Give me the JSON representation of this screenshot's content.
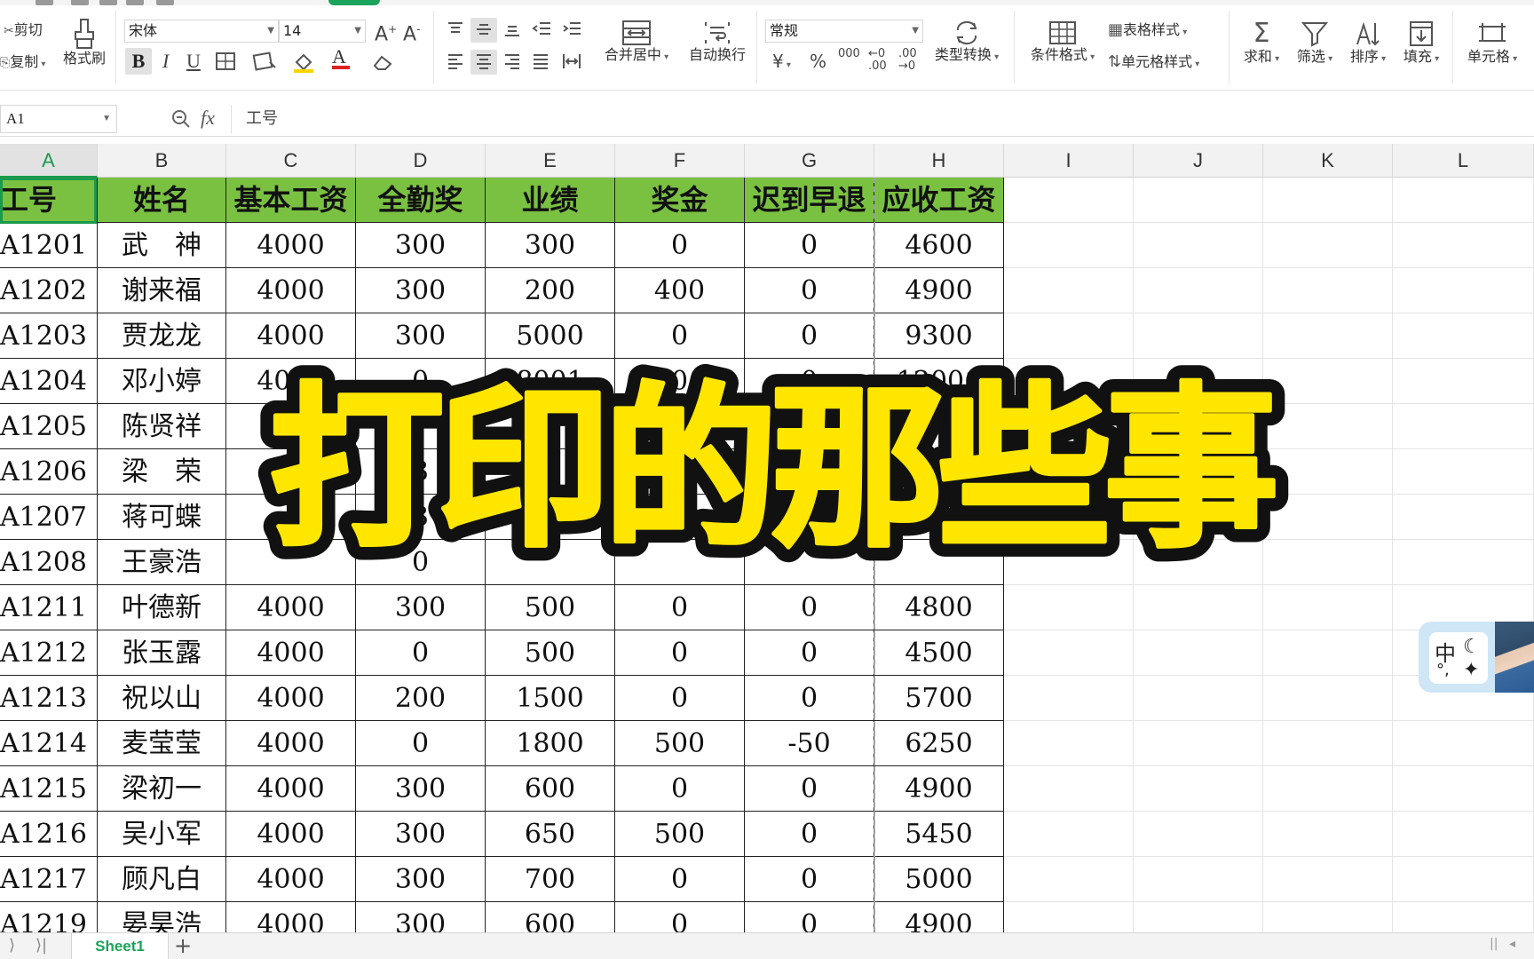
{
  "ribbon": {
    "clipboard": {
      "cut": "剪切",
      "copy": "复制",
      "format_painter": "格式刷"
    },
    "font": {
      "name": "宋体",
      "size": "14",
      "bold": "B",
      "italic": "I",
      "underline": "U",
      "color_letter": "A"
    },
    "alignment": {
      "merge_center": "合并居中",
      "wrap_text": "自动换行"
    },
    "number": {
      "format": "常规",
      "currency": "¥",
      "percent": "%",
      "thousands": "000",
      "type_convert": "类型转换"
    },
    "styles": {
      "conditional_format": "条件格式",
      "table_style": "表格样式",
      "cell_style": "单元格样式"
    },
    "editing": {
      "sum": "求和",
      "filter": "筛选",
      "sort": "排序",
      "fill": "填充",
      "cell": "单元格"
    },
    "accent_color": "#1aa35a"
  },
  "formula_bar": {
    "name_box": "A1",
    "fx": "fx",
    "content": "工号"
  },
  "columns": [
    "A",
    "B",
    "C",
    "D",
    "E",
    "F",
    "G",
    "H",
    "I",
    "J",
    "K",
    "L"
  ],
  "table": {
    "header": [
      "工号",
      "姓名",
      "基本工资",
      "全勤奖",
      "业绩",
      "奖金",
      "迟到早退",
      "应收工资"
    ],
    "header_color": "#7ac142",
    "rows": [
      [
        "A1201",
        "武　神",
        "4000",
        "300",
        "300",
        "0",
        "0",
        "4600"
      ],
      [
        "A1202",
        "谢来福",
        "4000",
        "300",
        "200",
        "400",
        "0",
        "4900"
      ],
      [
        "A1203",
        "贾龙龙",
        "4000",
        "300",
        "5000",
        "0",
        "0",
        "9300"
      ],
      [
        "A1204",
        "邓小婷",
        "4000",
        "0",
        "8001",
        "0",
        "0",
        "12001"
      ],
      [
        "A1205",
        "陈贤祥",
        "",
        "",
        "",
        "",
        "",
        ""
      ],
      [
        "A1206",
        "梁　荣",
        "",
        "3",
        "",
        "",
        "",
        ""
      ],
      [
        "A1207",
        "蒋可蝶",
        "",
        "3",
        "",
        "",
        "",
        ""
      ],
      [
        "A1208",
        "王豪浩",
        "",
        "0",
        "",
        "",
        "",
        ""
      ],
      [
        "A1211",
        "叶德新",
        "4000",
        "300",
        "500",
        "0",
        "0",
        "4800"
      ],
      [
        "A1212",
        "张玉露",
        "4000",
        "0",
        "500",
        "0",
        "0",
        "4500"
      ],
      [
        "A1213",
        "祝以山",
        "4000",
        "200",
        "1500",
        "0",
        "0",
        "5700"
      ],
      [
        "A1214",
        "麦莹莹",
        "4000",
        "0",
        "1800",
        "500",
        "-50",
        "6250"
      ],
      [
        "A1215",
        "梁初一",
        "4000",
        "300",
        "600",
        "0",
        "0",
        "4900"
      ],
      [
        "A1216",
        "吴小军",
        "4000",
        "300",
        "650",
        "500",
        "0",
        "5450"
      ],
      [
        "A1217",
        "顾凡白",
        "4000",
        "300",
        "700",
        "0",
        "0",
        "5000"
      ],
      [
        "A1219",
        "晏昊浩",
        "4000",
        "300",
        "600",
        "0",
        "0",
        "4900"
      ]
    ]
  },
  "overlay": {
    "title": "打印的那些事",
    "fill_color": "#ffe600",
    "stroke_color": "#111111"
  },
  "ime": {
    "zh": "中",
    "moon": "☾",
    "punct": "°,",
    "butterfly": "✦"
  },
  "sheet_bar": {
    "tab": "Sheet1",
    "add": "+"
  }
}
